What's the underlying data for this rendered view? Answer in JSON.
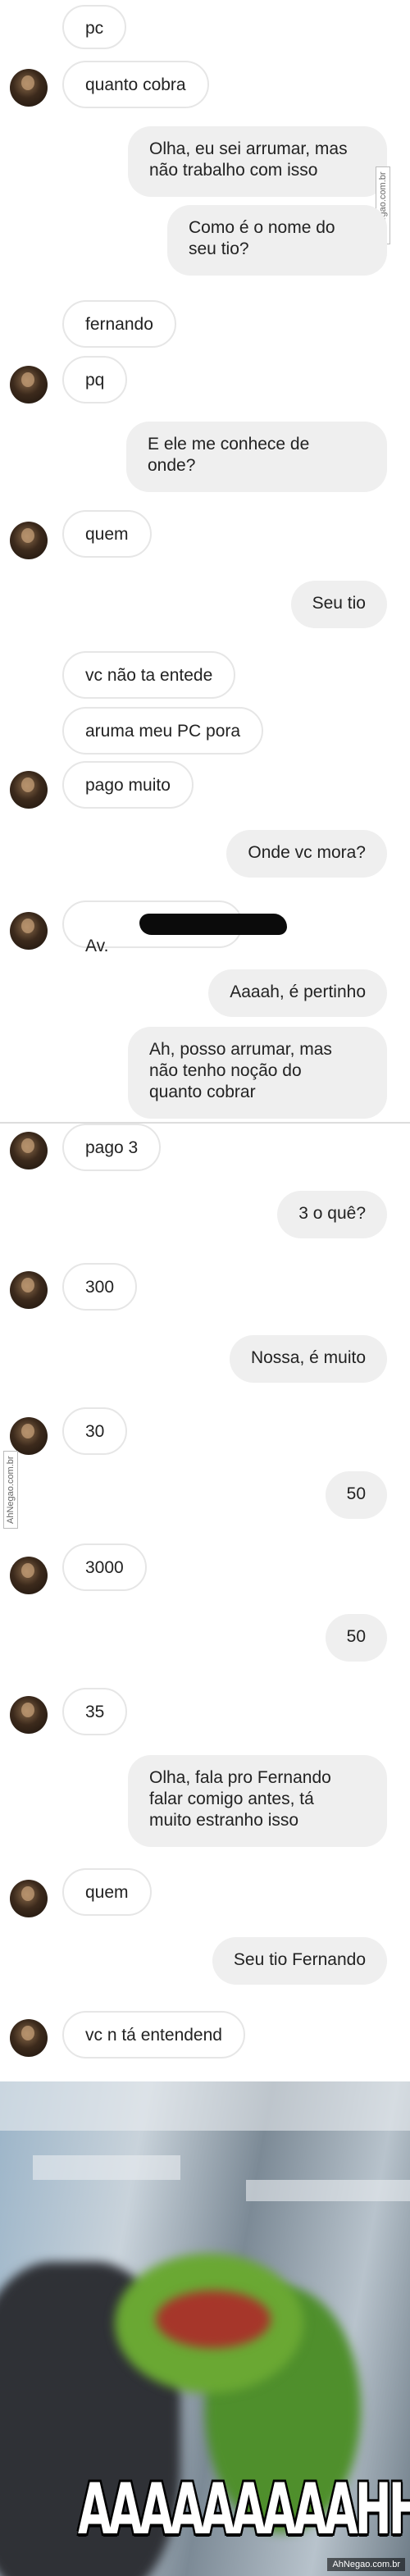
{
  "watermark": "AhNegao.com.br",
  "messages": [
    {
      "side": "in",
      "text": "pc"
    },
    {
      "side": "in",
      "text": "quanto cobra"
    },
    {
      "side": "out",
      "text": "Olha, eu sei arrumar, mas\nnão trabalho com isso"
    },
    {
      "side": "out",
      "text": "Como é o nome do\nseu tio?"
    },
    {
      "side": "in",
      "text": "fernando"
    },
    {
      "side": "in",
      "text": "pq"
    },
    {
      "side": "out",
      "text": "E ele me conhece de\nonde?"
    },
    {
      "side": "in",
      "text": "quem"
    },
    {
      "side": "out",
      "text": "Seu tio"
    },
    {
      "side": "in",
      "text": "vc não ta entede"
    },
    {
      "side": "in",
      "text": "aruma meu PC pora"
    },
    {
      "side": "in",
      "text": "pago muito"
    },
    {
      "side": "out",
      "text": "Onde vc mora?"
    },
    {
      "side": "in",
      "text": "Av."
    },
    {
      "side": "out",
      "text": "Aaaah, é pertinho"
    },
    {
      "side": "out",
      "text": "Ah, posso arrumar, mas\nnão tenho noção do\nquanto cobrar"
    },
    {
      "side": "in",
      "text": "pago 3"
    },
    {
      "side": "out",
      "text": "3 o quê?"
    },
    {
      "side": "in",
      "text": "300"
    },
    {
      "side": "out",
      "text": "Nossa, é muito"
    },
    {
      "side": "in",
      "text": "30"
    },
    {
      "side": "out",
      "text": "50"
    },
    {
      "side": "in",
      "text": "3000"
    },
    {
      "side": "out",
      "text": "50"
    },
    {
      "side": "in",
      "text": "35"
    },
    {
      "side": "out",
      "text": "Olha, fala pro Fernando\nfalar comigo antes, tá\nmuito estranho isso"
    },
    {
      "side": "in",
      "text": "quem"
    },
    {
      "side": "out",
      "text": "Seu tio Fernando"
    },
    {
      "side": "in",
      "text": "vc n tá entendend"
    }
  ],
  "meme": {
    "caption": "AAAAAAAAAHHHH"
  },
  "colors": {
    "incoming_bubble": "#ffffff",
    "incoming_border": "#e6e6e6",
    "outgoing_bubble": "#efefef",
    "text": "#222222"
  }
}
